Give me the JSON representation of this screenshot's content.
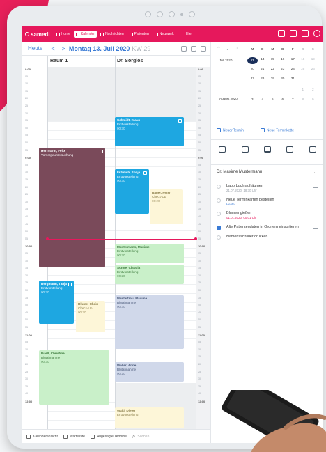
{
  "topbar": {
    "brand": "samedi",
    "nav": [
      {
        "label": "Home",
        "icon": "home-icon",
        "active": false
      },
      {
        "label": "Kalender",
        "icon": "calendar-icon",
        "active": true
      },
      {
        "label": "Nachrichten",
        "icon": "messages-icon",
        "active": false
      },
      {
        "label": "Patienten",
        "icon": "patients-icon",
        "active": false
      },
      {
        "label": "Netzwerk",
        "icon": "network-icon",
        "active": false
      },
      {
        "label": "Hilfe",
        "icon": "help-icon",
        "active": false
      }
    ]
  },
  "toolbar": {
    "today": "Heute",
    "prev": "<",
    "next": ">",
    "date": "Montag 13. Juli 2020",
    "kw": "KW 29"
  },
  "calendar": {
    "columns": [
      "Raum 1",
      "Dr. Sorglos"
    ],
    "times": [
      {
        "t": "8:00",
        "hour": true
      },
      {
        "t": "05"
      },
      {
        "t": "10"
      },
      {
        "t": "15"
      },
      {
        "t": "20"
      },
      {
        "t": "25"
      },
      {
        "t": "30"
      },
      {
        "t": "35"
      },
      {
        "t": "40"
      },
      {
        "t": "45"
      },
      {
        "t": "50"
      },
      {
        "t": "55"
      },
      {
        "t": "9:00",
        "hour": true
      },
      {
        "t": "05"
      },
      {
        "t": "10"
      },
      {
        "t": "15"
      },
      {
        "t": "20"
      },
      {
        "t": "25"
      },
      {
        "t": "30"
      },
      {
        "t": "35"
      },
      {
        "t": "40"
      },
      {
        "t": "45"
      },
      {
        "t": "50"
      },
      {
        "t": "55"
      },
      {
        "t": "10:00",
        "hour": true
      },
      {
        "t": "05"
      },
      {
        "t": "10"
      },
      {
        "t": "15"
      },
      {
        "t": "20"
      },
      {
        "t": "25"
      },
      {
        "t": "30"
      },
      {
        "t": "35"
      },
      {
        "t": "40"
      },
      {
        "t": "45"
      },
      {
        "t": "50"
      },
      {
        "t": "55"
      },
      {
        "t": "11:00",
        "hour": true
      },
      {
        "t": "05"
      },
      {
        "t": "10"
      },
      {
        "t": "15"
      },
      {
        "t": "20"
      },
      {
        "t": "25"
      },
      {
        "t": "30"
      },
      {
        "t": "35"
      },
      {
        "t": "40"
      },
      {
        "t": "12:00",
        "hour": true
      }
    ],
    "appointments": [
      {
        "name": "Herrmann, Felix",
        "sub": "Vorsorgeuntersuchung",
        "time": "",
        "color": "#7a4a5a",
        "fg": "#ffffff"
      },
      {
        "name": "Schmidt, Klaus",
        "sub": "Erstvorstellung",
        "time": "00:30",
        "color": "#1ea7e1",
        "fg": "#ffffff"
      },
      {
        "name": "Fröhlich, Sonja",
        "sub": "Erstvorstellung",
        "time": "00:30",
        "color": "#1ea7e1",
        "fg": "#ffffff"
      },
      {
        "name": "Bauer, Peter",
        "sub": "Check-Up",
        "time": "00:20",
        "color": "#fdf6d8",
        "fg": "#8a7d4a"
      },
      {
        "name": "Mustermann, Maxime",
        "sub": "Erstvorstellung",
        "time": "00:20",
        "color": "#c9f0c9",
        "fg": "#3c7a3c"
      },
      {
        "name": "Sonne, Claudia",
        "sub": "Erstvorstellung",
        "time": "00:20",
        "color": "#c9f0c9",
        "fg": "#3c7a3c"
      },
      {
        "name": "Bergmann, Tanja",
        "sub": "Erstvorstellung",
        "time": "00:30",
        "color": "#1ea7e1",
        "fg": "#ffffff"
      },
      {
        "name": "Blume, Chris",
        "sub": "Check-Up",
        "time": "00:20",
        "color": "#fdf6d8",
        "fg": "#8a7d4a"
      },
      {
        "name": "Musterfrau, Maxime",
        "sub": "Blutabnahme",
        "time": "00:30",
        "color": "#d0d8ea",
        "fg": "#4a5a7a"
      },
      {
        "name": "Duell, Christine",
        "sub": "Blutabnahme",
        "time": "00:30",
        "color": "#c9f0c9",
        "fg": "#3c7a3c"
      },
      {
        "name": "Weller, Anne",
        "sub": "Blutabnahme",
        "time": "00:20",
        "color": "#d0d8ea",
        "fg": "#4a5a7a"
      },
      {
        "name": "Wald, Dieter",
        "sub": "Erstvorstellung",
        "time": "",
        "color": "#fdf6d8",
        "fg": "#8a7d4a"
      }
    ]
  },
  "bottombar": {
    "items": [
      "Kalenderansicht",
      "Warteliste",
      "Abgesagte Termine"
    ],
    "search_placeholder": "Suchen"
  },
  "sidebar": {
    "weekdays": [
      "M",
      "D",
      "M",
      "D",
      "F",
      "S",
      "S"
    ],
    "month_jul": "Juli 2020",
    "month_aug": "August 2020",
    "rows": [
      [
        "13",
        "14",
        "15",
        "16",
        "17",
        "18",
        "19"
      ],
      [
        "20",
        "21",
        "22",
        "23",
        "24",
        "25",
        "26"
      ],
      [
        "27",
        "28",
        "29",
        "30",
        "31",
        "",
        ""
      ],
      [
        "",
        "",
        "",
        "",
        "",
        "1",
        "2"
      ],
      [
        "3",
        "4",
        "5",
        "6",
        "7",
        "8",
        "9"
      ]
    ],
    "new_appointment": "Neuer Termin",
    "new_card": "Neue Terminkette",
    "doctor": "Dr. Maxime Mustermann",
    "tasks": [
      {
        "title": "Laborbuch aufräumen",
        "meta": "21.07.2020, 18:30 Uhr",
        "meta_style": "",
        "done": false,
        "tag": true
      },
      {
        "title": "Neue Terminkarten bestellen",
        "meta": "Heute",
        "meta_style": "blue",
        "done": false,
        "tag": false
      },
      {
        "title": "Blumen gießen",
        "meta": "01.01.2020, 00:01 Uhr",
        "meta_style": "red",
        "done": false,
        "tag": false
      },
      {
        "title": "Alte Patientendaten in Ordnern einsortieren",
        "meta": "",
        "meta_style": "",
        "done": true,
        "tag": true
      },
      {
        "title": "Namensschilder drucken",
        "meta": "",
        "meta_style": "",
        "done": false,
        "tag": false
      }
    ]
  }
}
